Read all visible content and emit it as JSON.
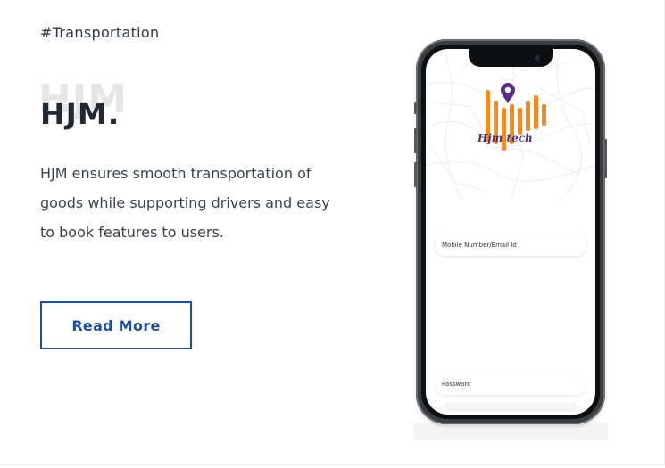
{
  "card": {
    "tag": "#Transportation",
    "title_ghost": "HJM",
    "title": "HJM.",
    "description": "HJM ensures smooth transportation of goods while supporting drivers and easy to book features to users.",
    "read_more_label": "Read More"
  },
  "phone": {
    "logo_text": "Hjm tech",
    "mobile_placeholder": "Mobile Number/Email Id",
    "password_placeholder": "Password"
  },
  "colors": {
    "accent": "#1f4e9c",
    "logo_orange": "#f08a24",
    "logo_purple": "#4a2e7a"
  }
}
